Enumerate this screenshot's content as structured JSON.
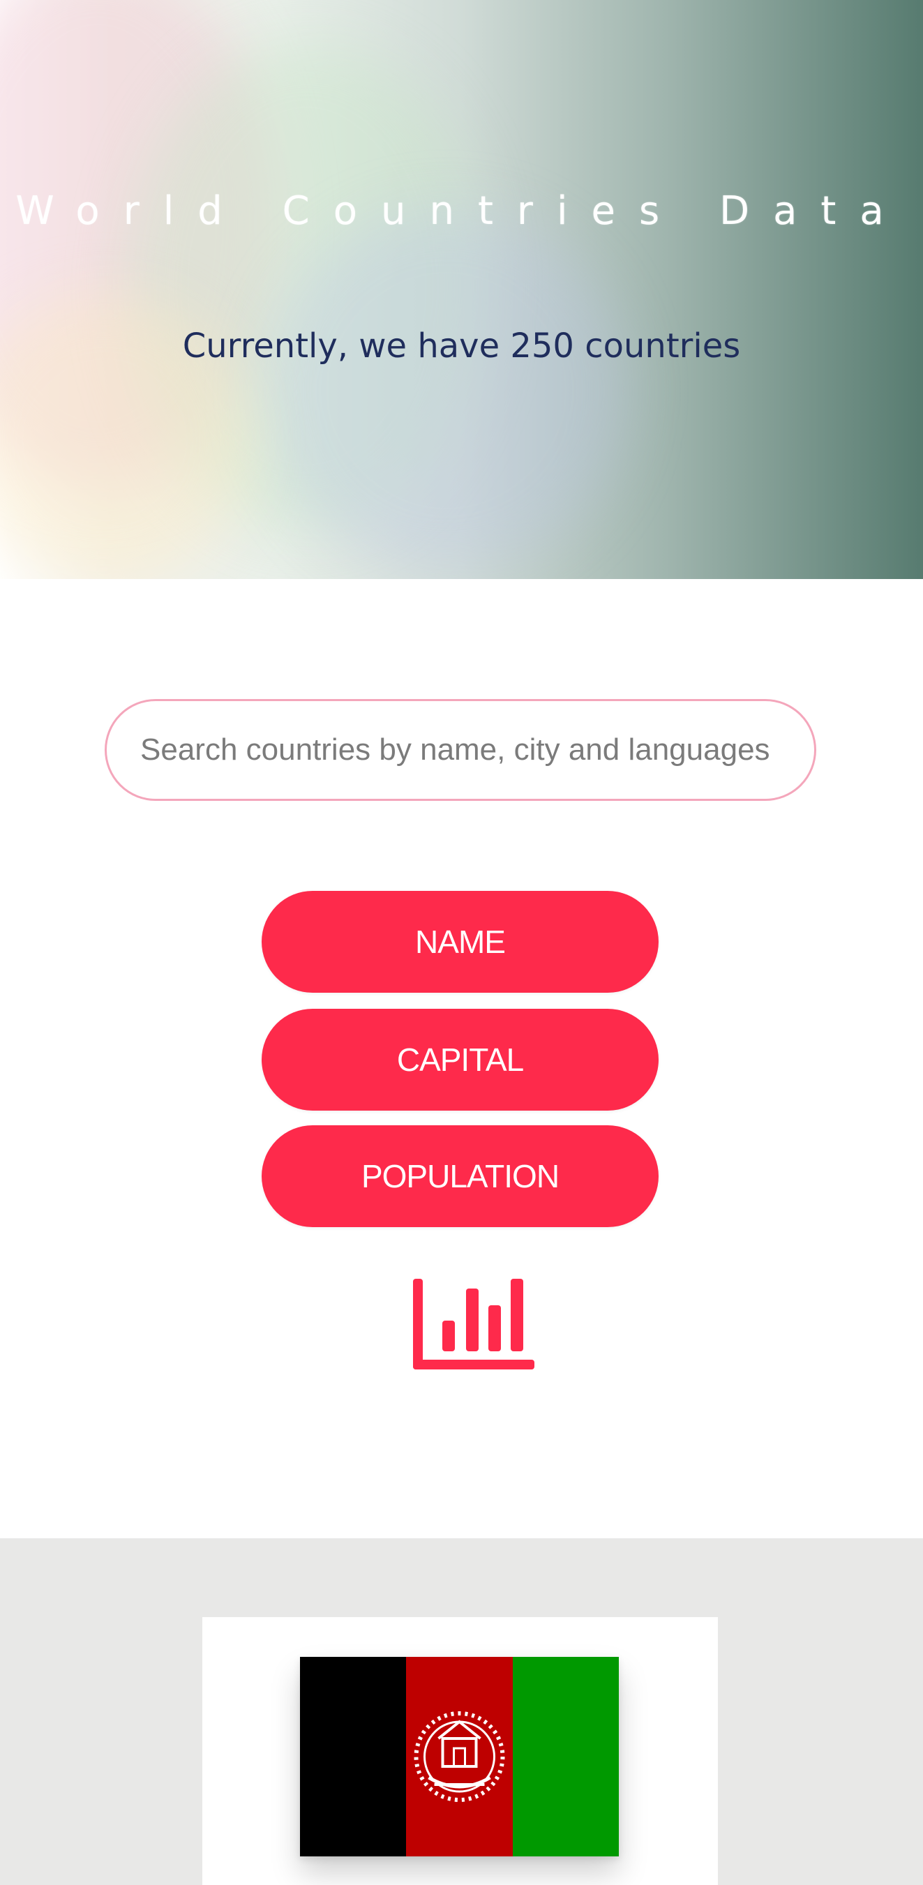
{
  "hero": {
    "title": "World Countries Data",
    "subtitle": "Currently, we have 250 countries"
  },
  "search": {
    "placeholder": "Search countries by name, city and languages"
  },
  "sort_buttons": {
    "name": "NAME",
    "capital": "CAPITAL",
    "population": "POPULATION"
  },
  "icons": {
    "stats": "bar-chart-icon",
    "flag": "afghanistan-flag"
  },
  "colors": {
    "accent": "#fe2a4b",
    "search_border": "#f4a6bb",
    "subtitle": "#1f2d5c",
    "section_bg": "#e8e8e7",
    "flag_black": "#000000",
    "flag_red": "#be0000",
    "flag_green": "#009900"
  }
}
